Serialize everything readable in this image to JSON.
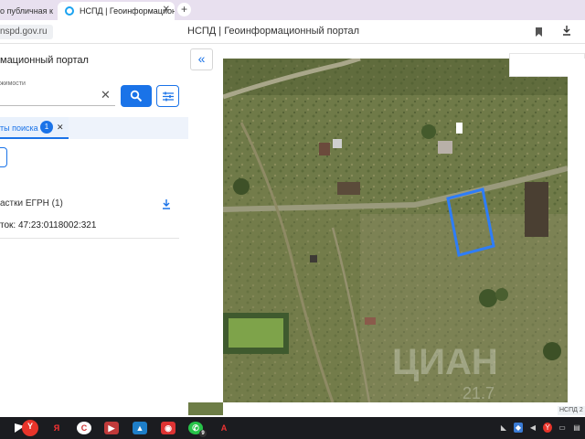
{
  "browser": {
    "tabs": [
      {
        "title": "о публичная кадастровая",
        "active": false
      },
      {
        "title": "НСПД | Геоинформационный портал",
        "active": true
      }
    ],
    "new_tab_symbol": "+",
    "url": "nspd.gov.ru",
    "page_title": "НСПД | Геоинформационный портал"
  },
  "panel": {
    "title": "мационный портал",
    "search_label": "жимости",
    "search_value": "",
    "results_tab_label": "ты поиска",
    "results_count": "1",
    "group_title": "астки ЕГРН (1)",
    "cadastral_item": "ток: 47:23:0118002:321"
  },
  "map": {
    "collapse_symbol": "«",
    "attribution": "НСПД 2",
    "watermark_line1": "ЦИАН",
    "watermark_line2": "21.7"
  },
  "taskbar": {
    "apps": [
      "start",
      "yandex-browser",
      "yandex",
      "ccleaner",
      "video",
      "store",
      "media",
      "whatsapp",
      "acrobat"
    ],
    "whatsapp_badge": "9",
    "tray": [
      "network-icon",
      "shield-icon",
      "volume-icon",
      "yandex-tray-icon",
      "keyboard-icon",
      "chat-icon"
    ]
  },
  "colors": {
    "accent": "#1a73e8",
    "parcel_outline": "#2e7df7",
    "tab_strip": "#e8e0ef",
    "taskbar": "#1b1c20"
  }
}
